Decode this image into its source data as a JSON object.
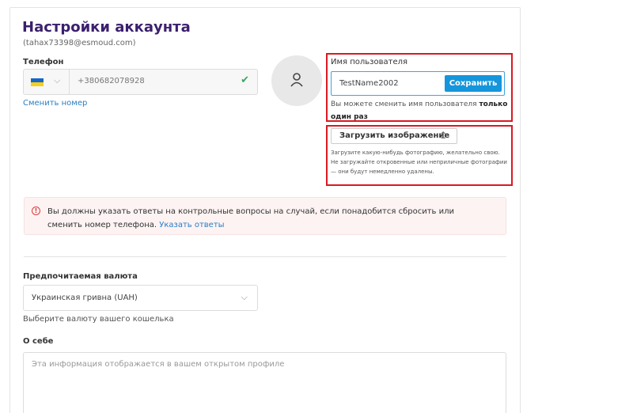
{
  "header": {
    "title": "Настройки аккаунта",
    "email": "(tahax73398@esmoud.com)"
  },
  "phone": {
    "label": "Телефон",
    "country_flag": "ukraine-flag",
    "number": "+380682078928",
    "change_link": "Сменить номер"
  },
  "username": {
    "label": "Имя пользователя",
    "value": "TestName2002",
    "save_label": "Сохранить",
    "hint_prefix": "Вы можете сменить имя пользователя",
    "hint_bold": "только один раз"
  },
  "upload": {
    "button_label": "Загрузить изображение",
    "hint": "Загрузите какую-нибудь фотографию, желательно свою. Не загружайте откровенные или неприличные фотографии — они будут немедленно удалены."
  },
  "alert": {
    "text": "Вы должны указать ответы на контрольные вопросы на случай, если понадобится сбросить или сменить номер телефона.",
    "link": "Указать ответы"
  },
  "currency": {
    "label": "Предпочитаемая валюта",
    "selected": "Украинская гривна (UAH)",
    "hint": "Выберите валюту вашего кошелька"
  },
  "about": {
    "label": "О себе",
    "placeholder": "Эта информация отображается в вашем открытом профиле"
  },
  "colors": {
    "title": "#3b1f6e",
    "accent": "#1595db",
    "link": "#2a7dc3",
    "highlight_border": "#d91a22",
    "success": "#3aa65d",
    "alert_bg": "#fdf3f3"
  }
}
